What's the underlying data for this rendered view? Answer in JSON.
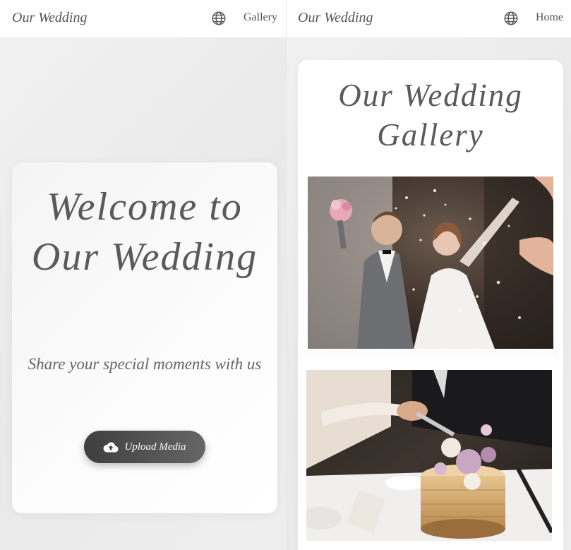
{
  "left_screen": {
    "header": {
      "brand": "Our Wedding",
      "globe_icon": "globe-icon",
      "nav_link": "Gallery"
    },
    "welcome": {
      "title": "Welcome to Our Wedding",
      "subtitle": "Share your special moments with us",
      "upload_button": {
        "label": "Upload Media",
        "icon": "cloud-upload-icon"
      }
    }
  },
  "right_screen": {
    "header": {
      "brand": "Our Wedding",
      "globe_icon": "globe-icon",
      "nav_link": "Home"
    },
    "gallery": {
      "title": "Our Wedding Gallery",
      "photos": [
        {
          "subject": "couple-confetti-photo"
        },
        {
          "subject": "cake-cutting-photo"
        }
      ]
    }
  },
  "colors": {
    "text_gray": "#5a5a5a",
    "button_dark": "#3e3e3e",
    "button_light": "#666666",
    "background": "#eeeeee"
  }
}
